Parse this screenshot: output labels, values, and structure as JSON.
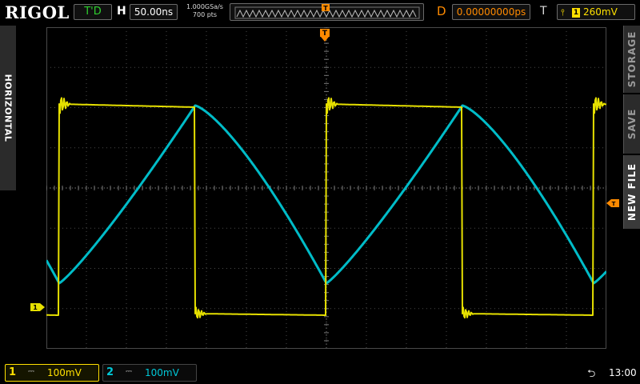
{
  "brand": "RIGOL",
  "status": {
    "run_state": "T'D"
  },
  "timebase": {
    "label": "H",
    "value": "50.00ns"
  },
  "acquisition": {
    "sample_rate": "1.000GSa/s",
    "points": "700  pts"
  },
  "delay": {
    "label": "D",
    "value": "0.00000000ps"
  },
  "trigger": {
    "label": "T",
    "channel": "1",
    "edge_icon": "rising-edge-icon",
    "level": "260mV"
  },
  "left_tab": {
    "label": "HORIZONTAL"
  },
  "right_tabs": [
    "STORAGE",
    "SAVE",
    "NEW FILE"
  ],
  "markers": {
    "ch1": "1",
    "trigger_level": "T",
    "trigger_position": "T"
  },
  "channels": [
    {
      "number": "1",
      "coupling": "⎓",
      "scale": "100mV",
      "color": "#e6e000",
      "active": true
    },
    {
      "number": "2",
      "coupling": "⎓",
      "scale": "100mV",
      "color": "#00bcc8",
      "active": false
    }
  ],
  "system": {
    "usb_icon": "usb-icon",
    "time": "13:00"
  },
  "colors": {
    "ch1": "#e6e000",
    "ch2": "#00bcc8",
    "trigger": "#ff8a00",
    "grid": "#4a4a4a"
  }
}
